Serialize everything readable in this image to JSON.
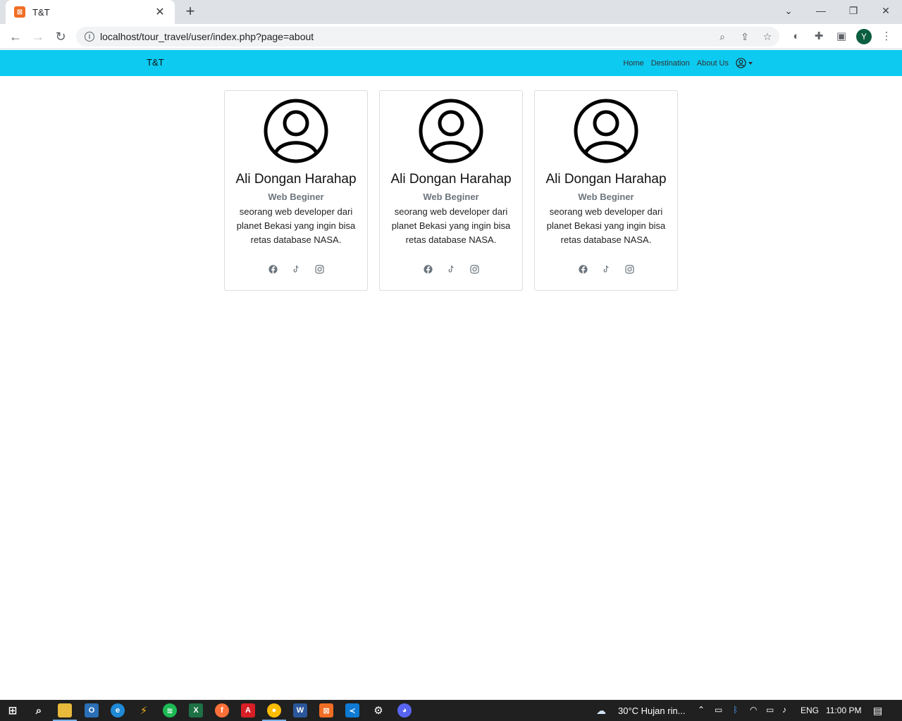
{
  "browser": {
    "tab_title": "T&T",
    "tab_favicon": "xampp-icon",
    "new_tab": "+",
    "url": "localhost/tour_travel/user/index.php?page=about",
    "profile_initial": "Y"
  },
  "navbar": {
    "brand": "T&T",
    "links": [
      "Home",
      "Destination",
      "About Us"
    ],
    "accent": "#0dcaf0"
  },
  "cards": [
    {
      "name": "Ali Dongan Harahap",
      "role": "Web Beginer",
      "description": "seorang web developer dari planet Bekasi yang ingin bisa retas database NASA.",
      "socials": [
        "facebook-icon",
        "tiktok-icon",
        "instagram-icon"
      ]
    },
    {
      "name": "Ali Dongan Harahap",
      "role": "Web Beginer",
      "description": "seorang web developer dari planet Bekasi yang ingin bisa retas database NASA.",
      "socials": [
        "facebook-icon",
        "tiktok-icon",
        "instagram-icon"
      ]
    },
    {
      "name": "Ali Dongan Harahap",
      "role": "Web Beginer",
      "description": "seorang web developer dari planet Bekasi yang ingin bisa retas database NASA.",
      "socials": [
        "facebook-icon",
        "tiktok-icon",
        "instagram-icon"
      ]
    }
  ],
  "taskbar": {
    "weather": "30°C  Hujan rin...",
    "language": "ENG",
    "time": "11:00 PM"
  }
}
